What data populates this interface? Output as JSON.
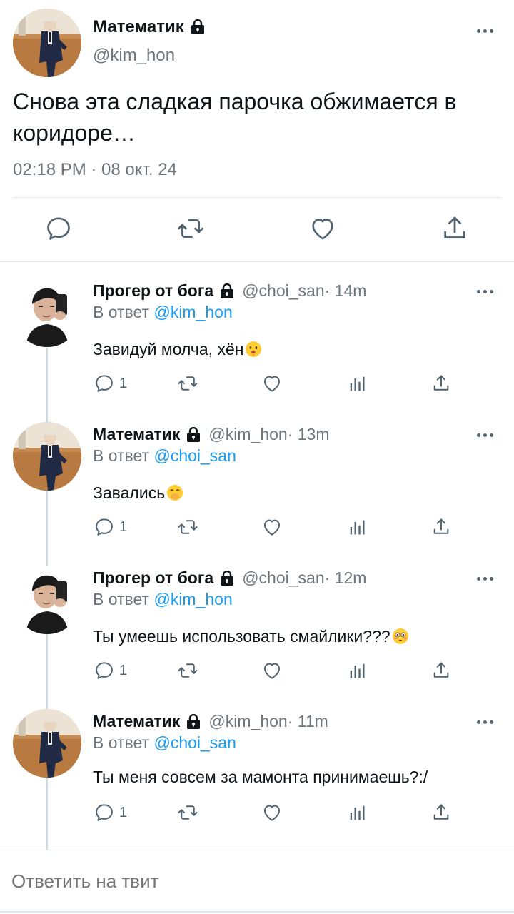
{
  "main_tweet": {
    "name": "Математик",
    "handle": "@kim_hon",
    "text": "Снова эта сладкая парочка обжимается в коридоре…",
    "timestamp": "02:18 PM · 08 окт. 24",
    "icons": [
      "reply-icon",
      "retweet-icon",
      "like-icon",
      "share-icon"
    ]
  },
  "replies": [
    {
      "name": "Прогер от бога",
      "handle": "@choi_san",
      "time": " · 14m",
      "reply_prefix": "В ответ ",
      "reply_to": "@kim_hon",
      "text": "Завидуй молча, хён",
      "emoji": "shushing-face",
      "reply_count": "1"
    },
    {
      "name": "Математик",
      "handle": "@kim_hon",
      "time": " · 13m",
      "reply_prefix": "В ответ ",
      "reply_to": "@choi_san",
      "text": "Завались",
      "emoji": "hand-over-mouth-face",
      "reply_count": "1"
    },
    {
      "name": "Прогер от бога",
      "handle": "@choi_san",
      "time": " · 12m",
      "reply_prefix": "В ответ ",
      "reply_to": "@kim_hon",
      "text": "Ты умеешь использовать смайлики???",
      "emoji": "flushed-face",
      "reply_count": "1"
    },
    {
      "name": "Математик",
      "handle": "@kim_hon",
      "time": " · 11m",
      "reply_prefix": "В ответ ",
      "reply_to": "@choi_san",
      "text": "Ты меня совсем за мамонта принимаешь?:/",
      "emoji": "",
      "reply_count": "1"
    }
  ],
  "reply_bar": {
    "placeholder": "Ответить на твит"
  },
  "colors": {
    "link": "#1d9bf0",
    "muted": "#6e767d",
    "text": "#0f1419",
    "divider": "#e1e8ed"
  }
}
